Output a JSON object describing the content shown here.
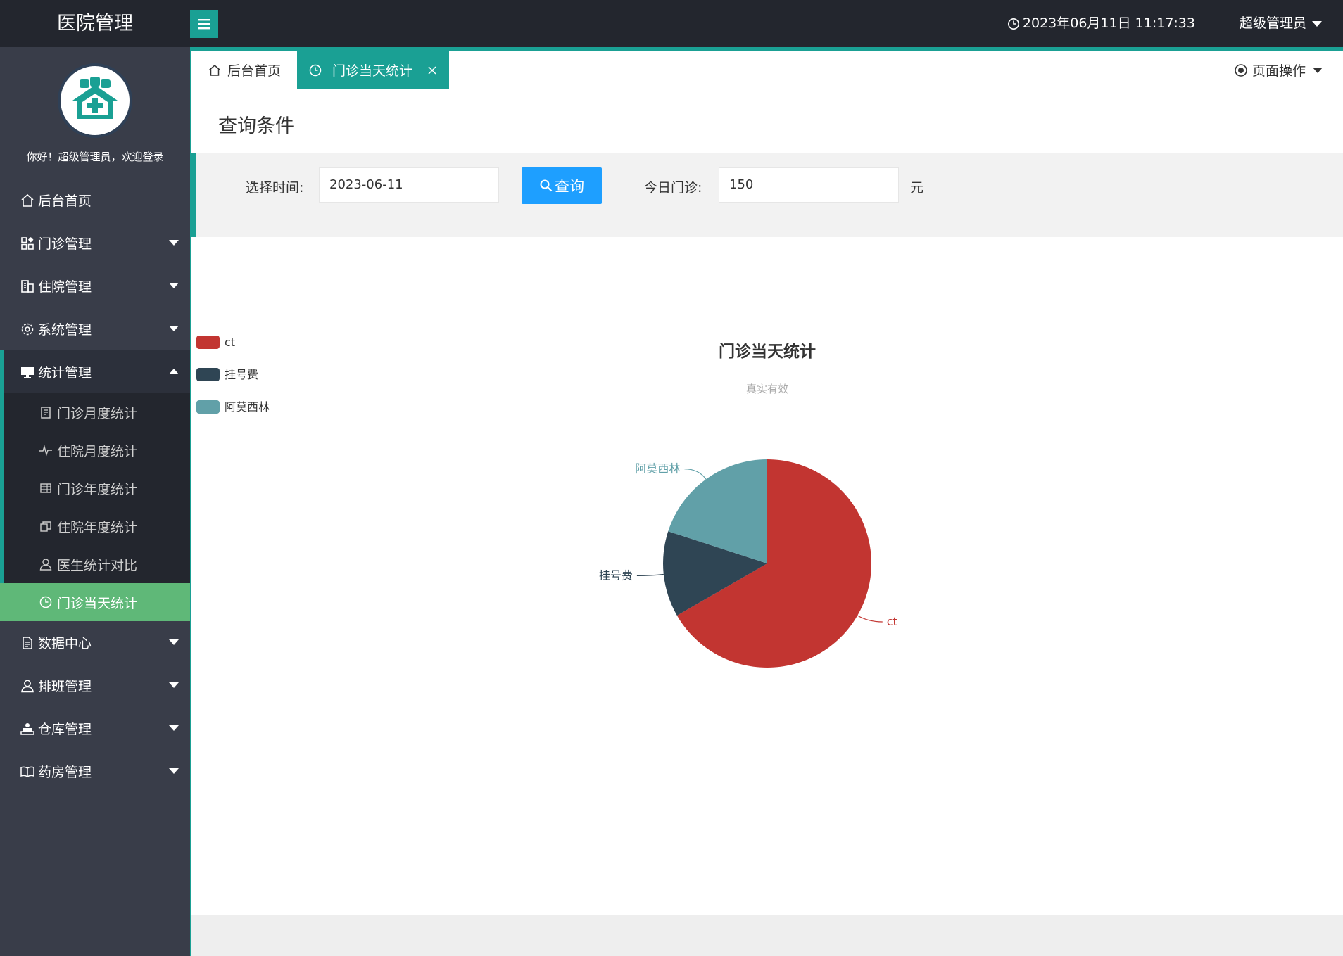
{
  "header": {
    "app_title": "医院管理",
    "datetime": "2023年06月11日 11:17:33",
    "user_menu": "超级管理员"
  },
  "sidebar": {
    "welcome": "你好！超级管理员，欢迎登录",
    "items": [
      {
        "label": "后台首页",
        "icon": "home-icon"
      },
      {
        "label": "门诊管理",
        "icon": "apps-icon"
      },
      {
        "label": "住院管理",
        "icon": "building-icon"
      },
      {
        "label": "系统管理",
        "icon": "gear-icon"
      },
      {
        "label": "统计管理",
        "icon": "monitor-icon"
      },
      {
        "label": "数据中心",
        "icon": "document-icon"
      },
      {
        "label": "排班管理",
        "icon": "user-icon"
      },
      {
        "label": "仓库管理",
        "icon": "warehouse-icon"
      },
      {
        "label": "药房管理",
        "icon": "book-icon"
      }
    ],
    "stats_children": [
      {
        "label": "门诊月度统计",
        "icon": "clipboard-icon"
      },
      {
        "label": "住院月度统计",
        "icon": "pulse-icon"
      },
      {
        "label": "门诊年度统计",
        "icon": "table-icon"
      },
      {
        "label": "住院年度统计",
        "icon": "copy-icon"
      },
      {
        "label": "医生统计对比",
        "icon": "user-icon"
      },
      {
        "label": "门诊当天统计",
        "icon": "clock-icon"
      }
    ]
  },
  "tabs": {
    "home": "后台首页",
    "current": "门诊当天统计",
    "page_ops": "页面操作"
  },
  "query": {
    "legend": "查询条件",
    "date_label": "选择时间:",
    "date_value": "2023-06-11",
    "search_button": "查询",
    "today_label": "今日门诊:",
    "today_value": "150",
    "unit": "元"
  },
  "colors": {
    "accent": "#1aa094",
    "button": "#1e9fff",
    "current_menu": "#5fb878"
  },
  "chart_data": {
    "type": "pie",
    "title": "门诊当天统计",
    "subtitle": "真实有效",
    "legend_position": "top-left",
    "categories": [
      "ct",
      "挂号费",
      "阿莫西林"
    ],
    "values": [
      100,
      20,
      30
    ],
    "colors": [
      "#c23531",
      "#2f4554",
      "#61a0a8"
    ]
  }
}
